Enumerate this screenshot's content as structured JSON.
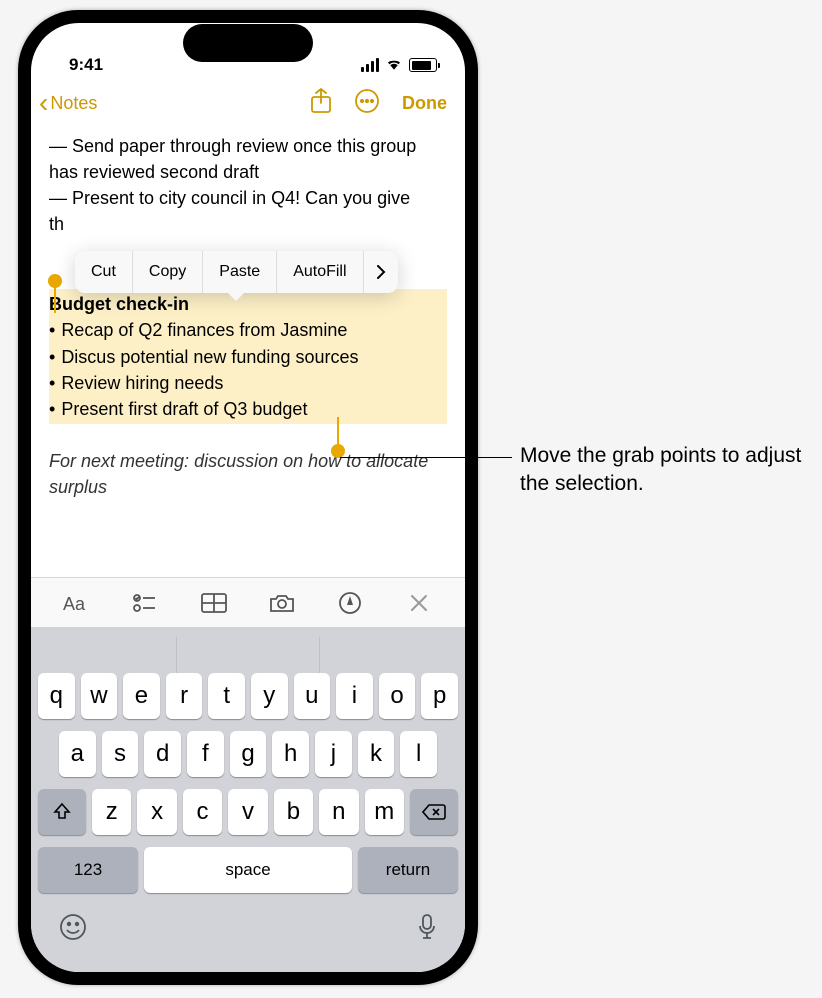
{
  "status": {
    "time": "9:41"
  },
  "nav": {
    "back_label": "Notes",
    "done_label": "Done"
  },
  "context_menu": {
    "cut": "Cut",
    "copy": "Copy",
    "paste": "Paste",
    "autofill": "AutoFill"
  },
  "note": {
    "line1": "— Send paper through review once this group has reviewed second draft",
    "line2": "— Present to city council in Q4! Can you give",
    "line3_prefix": "th",
    "selection": {
      "title": "Budget check-in",
      "bullets": [
        "Recap of Q2 finances from Jasmine",
        "Discus potential new funding sources",
        "Review hiring needs",
        "Present first draft of Q3 budget"
      ]
    },
    "footer": "For next meeting: discussion on how to allocate surplus"
  },
  "keyboard": {
    "row1": [
      "q",
      "w",
      "e",
      "r",
      "t",
      "y",
      "u",
      "i",
      "o",
      "p"
    ],
    "row2": [
      "a",
      "s",
      "d",
      "f",
      "g",
      "h",
      "j",
      "k",
      "l"
    ],
    "row3": [
      "z",
      "x",
      "c",
      "v",
      "b",
      "n",
      "m"
    ],
    "numbers": "123",
    "space": "space",
    "return": "return"
  },
  "callout": {
    "text": "Move the grab points to adjust the selection."
  }
}
